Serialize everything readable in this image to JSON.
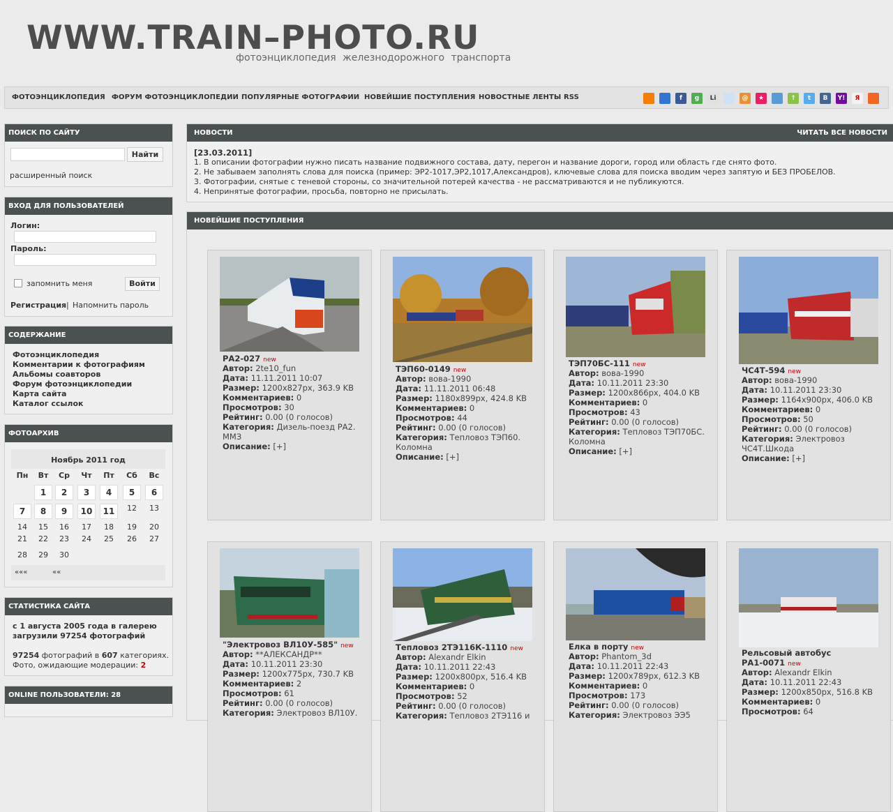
{
  "header": {
    "logo": "WWW.TRAIN–PHOTO.RU",
    "tagline": "фотоэнциклопедия железнодорожного транспорта"
  },
  "topnav": {
    "items": [
      "ФОТОЭНЦИКЛОПЕДИЯ",
      "ФОРУМ ФОТОЭНЦИКЛОПЕДИИ",
      "ПОПУЛЯРНЫЕ ФОТОГРАФИИ",
      "НОВЕЙШИЕ ПОСТУПЛЕНИЯ",
      "НОВОСТНЫЕ ЛЕНТЫ RSS"
    ],
    "social": [
      {
        "icon": "blogger-icon",
        "label": "",
        "color": "#f57d00"
      },
      {
        "icon": "delicious-icon",
        "label": "",
        "color": "#3274d1"
      },
      {
        "icon": "facebook-icon",
        "label": "f",
        "color": "#3b5998"
      },
      {
        "icon": "google-icon",
        "label": "g",
        "color": "#4caf50"
      },
      {
        "icon": "livejournal-icon",
        "label": "Li",
        "color": "#e0e0e0"
      },
      {
        "icon": "livejournal-pen-icon",
        "label": "",
        "color": "#cfe2f3"
      },
      {
        "icon": "mail-ru-icon",
        "label": "@",
        "color": "#e69138"
      },
      {
        "icon": "memori-icon",
        "label": "★",
        "color": "#e91e63"
      },
      {
        "icon": "moemesto-icon",
        "label": "",
        "color": "#5b9bd5"
      },
      {
        "icon": "news2-icon",
        "label": "↑",
        "color": "#8bc34a"
      },
      {
        "icon": "twitter-icon",
        "label": "t",
        "color": "#55acee"
      },
      {
        "icon": "vkontakte-icon",
        "label": "B",
        "color": "#45668e"
      },
      {
        "icon": "yahoo-icon",
        "label": "Y!",
        "color": "#720e9e"
      },
      {
        "icon": "yandex-icon",
        "label": "Я",
        "color": "#f2f2f2"
      },
      {
        "icon": "rss-icon",
        "label": "",
        "color": "#f26522"
      }
    ]
  },
  "search_box": {
    "heading": "ПОИСК ПО САЙТУ",
    "button": "Найти",
    "advanced": "расширенный поиск"
  },
  "login_box": {
    "heading": "ВХОД ДЛЯ ПОЛЬЗОВАТЕЛЕЙ",
    "login_label": "Логин:",
    "password_label": "Пароль:",
    "remember": "запомнить меня",
    "button": "Войти",
    "register": "Регистрация",
    "separator": "|",
    "remind": "Напомнить пароль"
  },
  "contents_box": {
    "heading": "СОДЕРЖАНИЕ",
    "links": [
      "Фотоэнциклопедия",
      "Комментарии к фотографиям",
      "Альбомы соавторов",
      "Форум фотоэнциклопедии",
      "Карта сайта",
      "Каталог ссылок"
    ]
  },
  "archive_box": {
    "heading": "ФОТОАРХИВ",
    "month": "Ноябрь 2011 год",
    "weekdays": [
      "Пн",
      "Вт",
      "Ср",
      "Чт",
      "Пт",
      "Сб",
      "Вс"
    ],
    "week1": [
      "1",
      "2",
      "3",
      "4",
      "5",
      "6"
    ],
    "week2": [
      "7",
      "8",
      "9",
      "10",
      "11",
      "12",
      "13"
    ],
    "week3": [
      "14",
      "15",
      "16",
      "17",
      "18",
      "19",
      "20"
    ],
    "week4": [
      "21",
      "22",
      "23",
      "24",
      "25",
      "26",
      "27"
    ],
    "week5": [
      "28",
      "29",
      "30"
    ],
    "prev_year": "«««",
    "prev_month": "««"
  },
  "stats_box": {
    "heading": "СТАТИСТИКА САЙТА",
    "since": "с 1 августа 2005 года в галерею загрузили 97254 фотографий",
    "count_a": "97254",
    "count_mid": " фотографий в ",
    "count_b": "607",
    "count_tail": " категориях.",
    "pending": "Фото, ожидающие модерации: ",
    "pending_num": "2"
  },
  "online_box": {
    "heading": "ONLINE ПОЛЬЗОВАТЕЛИ: 28"
  },
  "news": {
    "heading": "НОВОСТИ",
    "read_all": "ЧИТАТЬ ВСЕ НОВОСТИ",
    "date": "[23.03.2011]",
    "lines": [
      "1. В описании фотографии нужно писать название подвижного состава, дату, перегон и название дороги, город или область где снято фото.",
      "2. Не забываем заполнять слова для поиска (пример: ЭР2-1017,ЭР2,1017,Александров), ключевые слова для поиска вводим через запятую и БЕЗ ПРОБЕЛОВ.",
      "3. Фотографии, снятые с теневой стороны, со значительной потерей качества - не рассматриваются и не публикуются.",
      "4. Непринятые фотографии, просьба, повторно не присылать."
    ]
  },
  "latest": {
    "heading": "НОВЕЙШИЕ ПОСТУПЛЕНИЯ",
    "new_tag": "new",
    "labels": {
      "author": "Автор:",
      "date": "Дата:",
      "size": "Размер:",
      "comments": "Комментариев:",
      "views": "Просмотров:",
      "rating": "Рейтинг:",
      "category": "Категория:",
      "description": "Описание:"
    },
    "desc_toggle": "[+]",
    "cards": [
      {
        "title": "РА2-027",
        "author": "2te10_fun",
        "date": "11.11.2011 10:07",
        "size": "1200x827px, 363.9 KB",
        "comments": "0",
        "views": "30",
        "rating": "0.00 (0 голосов)",
        "category": "Дизель-поезд РА2. ММЗ"
      },
      {
        "title": "ТЭП60-0149",
        "author": "вова-1990",
        "date": "11.11.2011 06:48",
        "size": "1180x899px, 424.8 KB",
        "comments": "0",
        "views": "44",
        "rating": "0.00 (0 голосов)",
        "category": "Тепловоз ТЭП60. Коломна"
      },
      {
        "title": "ТЭП70БС-111",
        "author": "вова-1990",
        "date": "10.11.2011 23:30",
        "size": "1200x866px, 404.0 KB",
        "comments": "0",
        "views": "43",
        "rating": "0.00 (0 голосов)",
        "category": "Тепловоз ТЭП70БС. Коломна"
      },
      {
        "title": "ЧС4Т-594",
        "author": "вова-1990",
        "date": "10.11.2011 23:30",
        "size": "1164x900px, 406.0 KB",
        "comments": "0",
        "views": "50",
        "rating": "0.00 (0 голосов)",
        "category": "Электровоз ЧС4Т.Шкода"
      },
      {
        "title": "\"Электровоз ВЛ10У-585\"",
        "author": "**АЛЕКСАНДР**",
        "date": "10.11.2011 23:30",
        "size": "1200x775px, 730.7 KB",
        "comments": "2",
        "views": "61",
        "rating": "0.00 (0 голосов)",
        "category": "Электровоз ВЛ10У."
      },
      {
        "title": "Тепловоз 2ТЭ116К-1110",
        "author": "Alexandr Elkin",
        "date": "10.11.2011 22:43",
        "size": "1200x800px, 516.4 KB",
        "comments": "0",
        "views": "52",
        "rating": "0.00 (0 голосов)",
        "category": "Тепловоз 2ТЭ116 и"
      },
      {
        "title": "Елка в порту",
        "author": "Phantom_3d",
        "date": "10.11.2011 22:43",
        "size": "1200x789px, 612.3 KB",
        "comments": "0",
        "views": "173",
        "rating": "0.00 (0 голосов)",
        "category": "Электровоз ЭЭ5"
      },
      {
        "title": "Рельсовый автобус",
        "title2": "РА1-0071",
        "author": "Alexandr Elkin",
        "date": "10.11.2011 22:43",
        "size": "1200x850px, 516.8 KB",
        "comments": "0",
        "views": "64",
        "rating": "",
        "category": ""
      }
    ]
  }
}
